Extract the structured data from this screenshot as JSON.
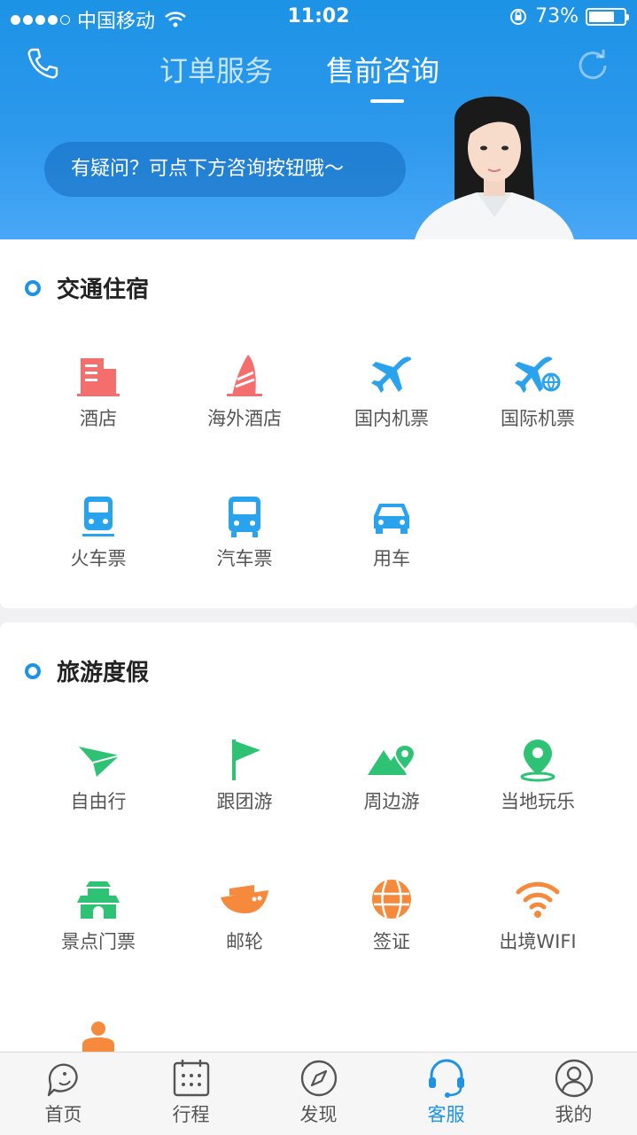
{
  "status_bar": {
    "carrier": "中国移动",
    "time": "11:02",
    "battery": "73%",
    "battery_level": 0.73
  },
  "header": {
    "tabs": [
      {
        "label": "订单服务",
        "active": false
      },
      {
        "label": "售前咨询",
        "active": true
      }
    ],
    "bubble_text": "有疑问？可点下方咨询按钮哦～"
  },
  "sections": [
    {
      "title": "交通住宿",
      "items": [
        {
          "label": "酒店",
          "icon": "hotel-icon",
          "color": "#f56e6e"
        },
        {
          "label": "海外酒店",
          "icon": "overseas-hotel-icon",
          "color": "#f56e6e"
        },
        {
          "label": "国内机票",
          "icon": "plane-icon",
          "color": "#2aa3ef"
        },
        {
          "label": "国际机票",
          "icon": "international-plane-icon",
          "color": "#2aa3ef"
        },
        {
          "label": "火车票",
          "icon": "train-icon",
          "color": "#2aa3ef"
        },
        {
          "label": "汽车票",
          "icon": "bus-icon",
          "color": "#2aa3ef"
        },
        {
          "label": "用车",
          "icon": "car-icon",
          "color": "#2aa3ef"
        }
      ]
    },
    {
      "title": "旅游度假",
      "items": [
        {
          "label": "自由行",
          "icon": "paper-plane-icon",
          "color": "#2ec374"
        },
        {
          "label": "跟团游",
          "icon": "flag-icon",
          "color": "#2ec374"
        },
        {
          "label": "周边游",
          "icon": "mountain-pin-icon",
          "color": "#2ec374"
        },
        {
          "label": "当地玩乐",
          "icon": "location-pin-icon",
          "color": "#2ec374"
        },
        {
          "label": "景点门票",
          "icon": "gate-icon",
          "color": "#2ec374"
        },
        {
          "label": "邮轮",
          "icon": "cruise-icon",
          "color": "#f58a3c"
        },
        {
          "label": "签证",
          "icon": "globe-icon",
          "color": "#f58a3c"
        },
        {
          "label": "出境WIFI",
          "icon": "wifi-icon",
          "color": "#f58a3c"
        }
      ]
    }
  ],
  "tabbar": [
    {
      "label": "首页",
      "icon": "home-dolphin-icon",
      "active": false
    },
    {
      "label": "行程",
      "icon": "calendar-icon",
      "active": false
    },
    {
      "label": "发现",
      "icon": "compass-icon",
      "active": false
    },
    {
      "label": "客服",
      "icon": "headset-icon",
      "active": true
    },
    {
      "label": "我的",
      "icon": "user-icon",
      "active": false
    }
  ],
  "colors": {
    "accent": "#1d93e6",
    "red": "#f56e6e",
    "blue": "#2aa3ef",
    "green": "#2ec374",
    "orange": "#f58a3c"
  }
}
